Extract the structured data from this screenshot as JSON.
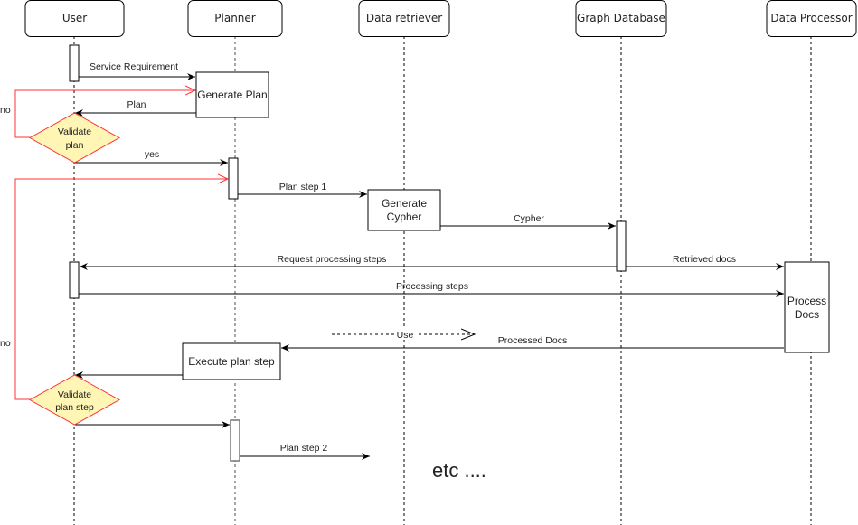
{
  "diagram": {
    "type": "sequence",
    "participants": [
      {
        "id": "user",
        "label": "User"
      },
      {
        "id": "planner",
        "label": "Planner"
      },
      {
        "id": "retriever",
        "label": "Data retriever"
      },
      {
        "id": "graphdb",
        "label": "Graph Database"
      },
      {
        "id": "processor",
        "label": "Data Processor"
      }
    ],
    "process_boxes": {
      "generate_plan": "Generate Plan",
      "generate_cypher_line1": "Generate",
      "generate_cypher_line2": "Cypher",
      "process_docs_line1": "Process",
      "process_docs_line2": "Docs",
      "execute_plan_step": "Execute plan step"
    },
    "decisions": {
      "validate_plan_line1": "Validate",
      "validate_plan_line2": "plan",
      "validate_step_line1": "Validate",
      "validate_step_line2": "plan step",
      "no_label_1": "no",
      "no_label_2": "no"
    },
    "messages": {
      "service_requirement": "Service Requirement",
      "plan": "Plan",
      "yes": "yes",
      "plan_step_1": "Plan step 1",
      "cypher": "Cypher",
      "request_processing_steps": "Request processing steps",
      "retrieved_docs": "Retrieved docs",
      "processing_steps": "Processing steps",
      "use": "Use",
      "processed_docs": "Processed Docs",
      "plan_step_2": "Plan step 2"
    },
    "footer_note": "etc ....",
    "colors": {
      "line": "#000000",
      "lifeline_planner": "#888888",
      "loop": "#ff3333",
      "decision_fill": "#fff5b5",
      "decision_stroke": "#ff3333"
    }
  }
}
